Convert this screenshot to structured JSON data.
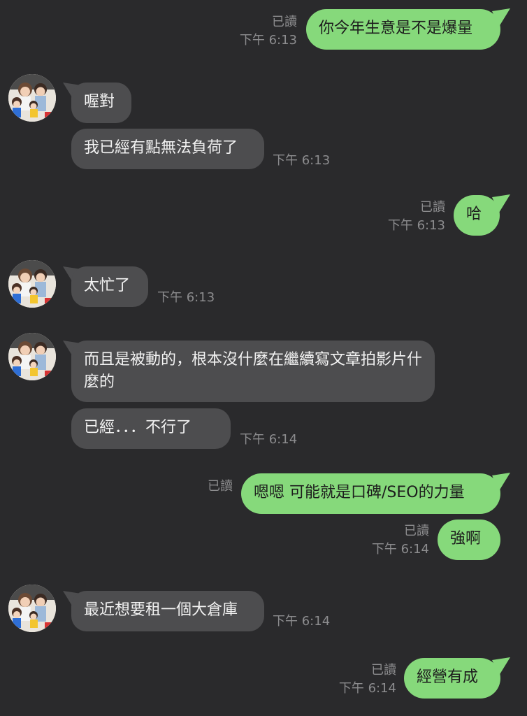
{
  "chat": {
    "contact_avatar_icon": "family-photo-avatar-icon",
    "colors": {
      "background": "#2a2a2c",
      "outgoing_bubble": "#86d97b",
      "incoming_bubble": "#4d4d4f",
      "meta_text": "#8c8c8e"
    },
    "messages": [
      {
        "direction": "outgoing",
        "text": "你今年生意是不是爆量",
        "read": "已讀",
        "time": "下午 6:13"
      },
      {
        "direction": "incoming",
        "text": "喔對"
      },
      {
        "direction": "incoming",
        "text": "我已經有點無法負荷了",
        "time": "下午 6:13"
      },
      {
        "direction": "outgoing",
        "text": "哈",
        "read": "已讀",
        "time": "下午 6:13"
      },
      {
        "direction": "incoming",
        "text": "太忙了",
        "time": "下午 6:13"
      },
      {
        "direction": "incoming",
        "text": "而且是被動的，根本沒什麼在繼續寫文章拍影片什麼的"
      },
      {
        "direction": "incoming",
        "text": "已經．．．不行了",
        "time": "下午 6:14"
      },
      {
        "direction": "outgoing",
        "text": "嗯嗯 可能就是口碑/SEO的力量",
        "read": "已讀"
      },
      {
        "direction": "outgoing",
        "text": "強啊",
        "read": "已讀",
        "time": "下午 6:14"
      },
      {
        "direction": "incoming",
        "text": "最近想要租一個大倉庫",
        "time": "下午 6:14"
      },
      {
        "direction": "outgoing",
        "text": "經營有成",
        "read": "已讀",
        "time": "下午 6:14"
      }
    ]
  }
}
